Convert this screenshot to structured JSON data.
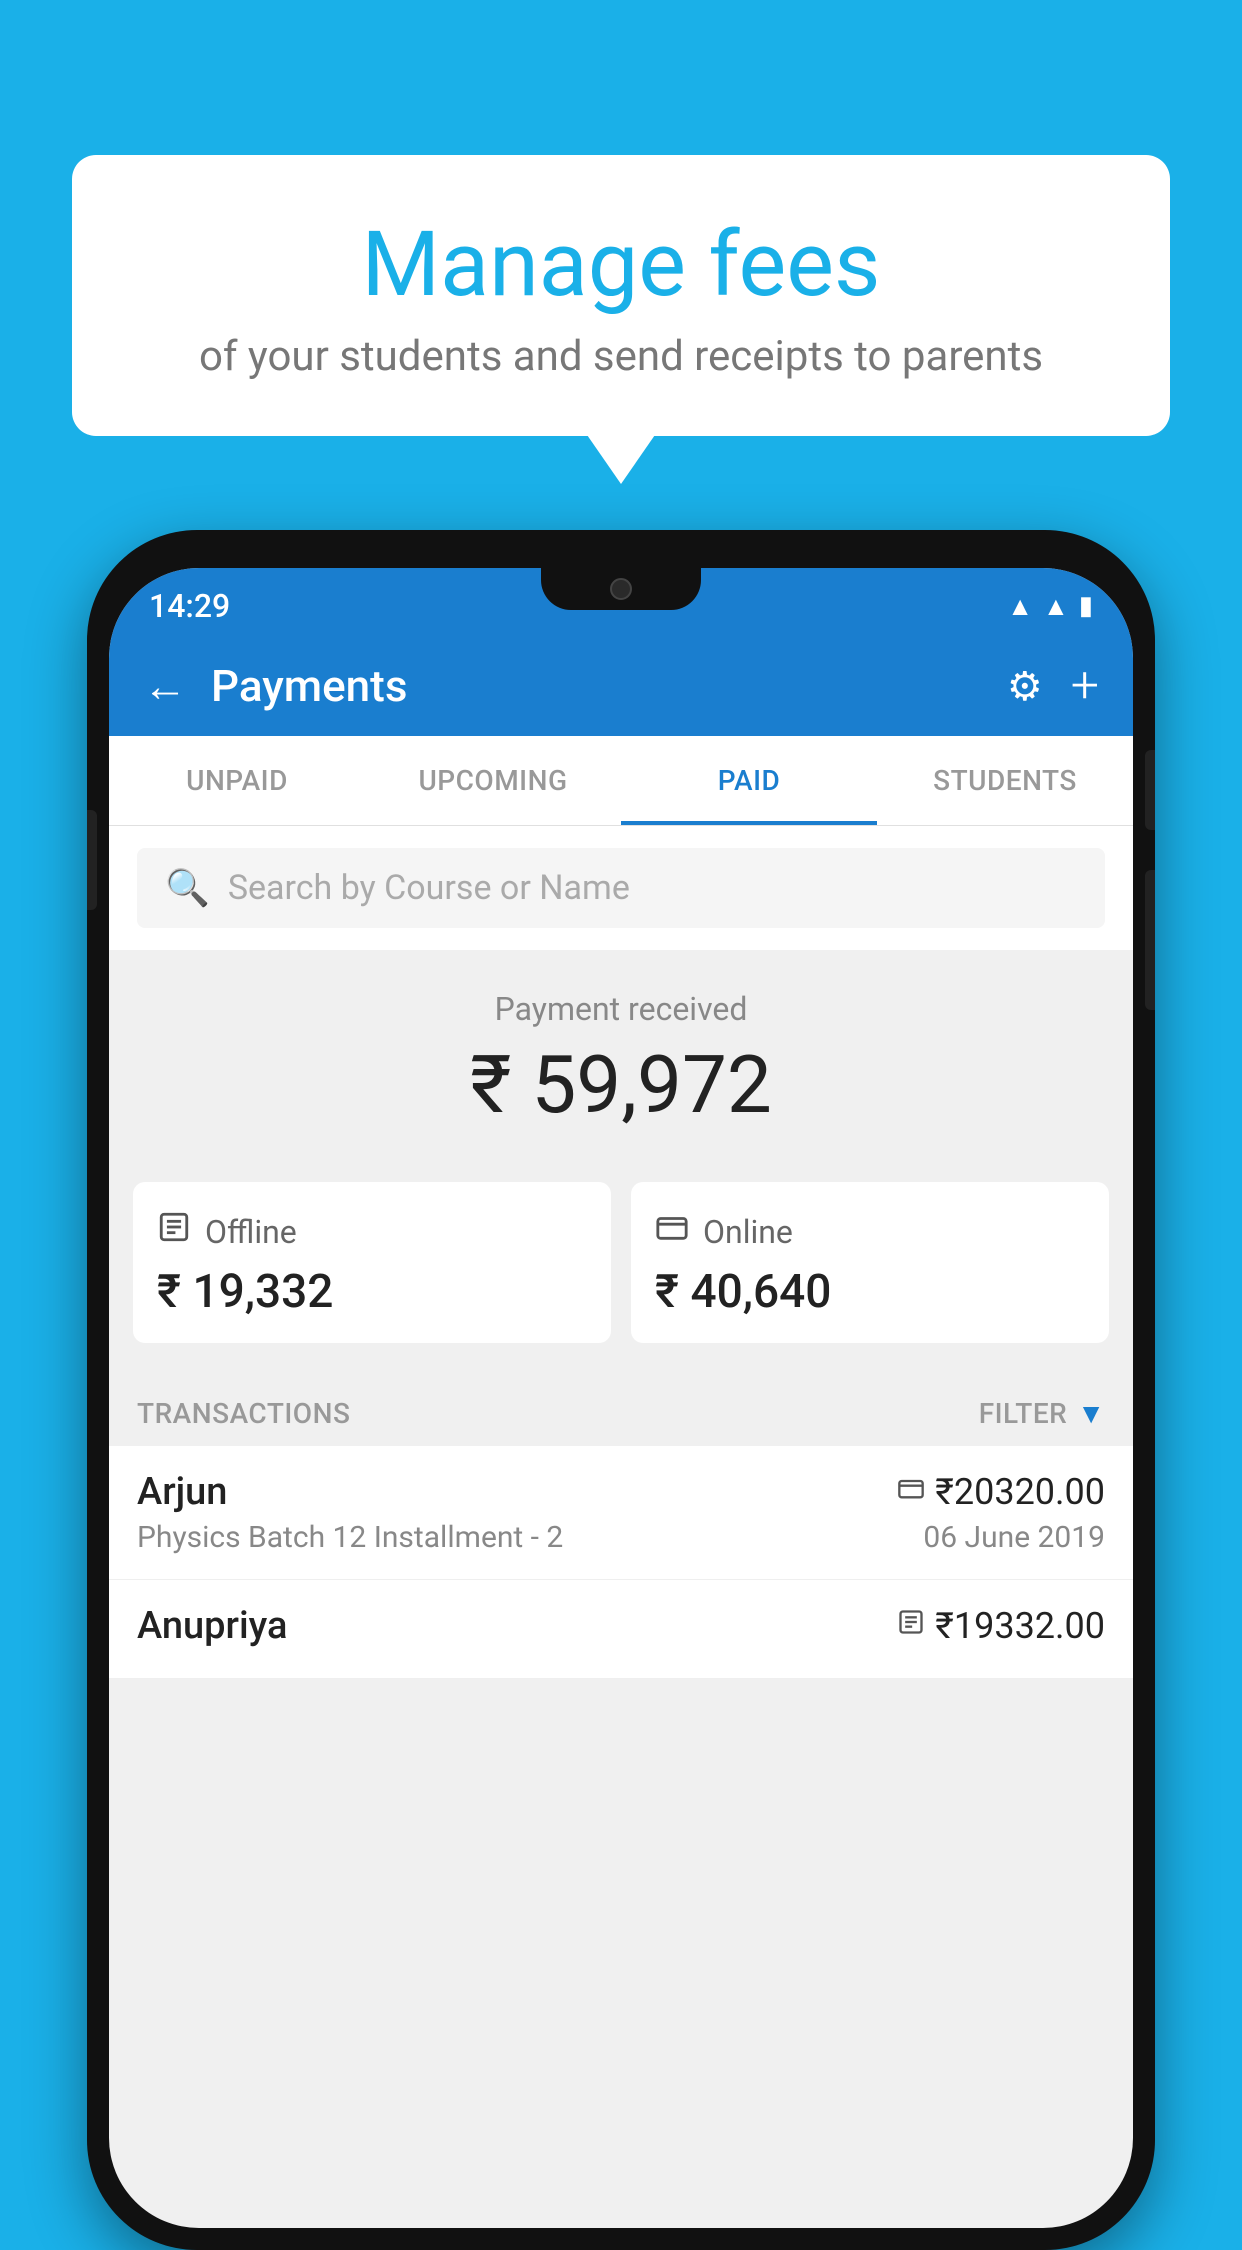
{
  "background_color": "#1ab0e8",
  "speech_bubble": {
    "title": "Manage fees",
    "subtitle": "of your students and send receipts to parents"
  },
  "status_bar": {
    "time": "14:29",
    "icons": [
      "wifi",
      "signal",
      "battery"
    ]
  },
  "app_bar": {
    "back_label": "←",
    "title": "Payments",
    "settings_icon": "⚙",
    "plus_icon": "+"
  },
  "tabs": [
    {
      "label": "UNPAID",
      "active": false
    },
    {
      "label": "UPCOMING",
      "active": false
    },
    {
      "label": "PAID",
      "active": true
    },
    {
      "label": "STUDENTS",
      "active": false
    }
  ],
  "search": {
    "placeholder": "Search by Course or Name"
  },
  "payment_summary": {
    "label": "Payment received",
    "amount": "₹ 59,972"
  },
  "payment_cards": [
    {
      "icon": "💳",
      "label": "Offline",
      "amount": "₹ 19,332"
    },
    {
      "icon": "💳",
      "label": "Online",
      "amount": "₹ 40,640"
    }
  ],
  "transactions_header": {
    "label": "TRANSACTIONS",
    "filter_label": "FILTER"
  },
  "transactions": [
    {
      "name": "Arjun",
      "payment_type": "online",
      "amount": "₹20320.00",
      "course": "Physics Batch 12 Installment - 2",
      "date": "06 June 2019"
    },
    {
      "name": "Anupriya",
      "payment_type": "offline",
      "amount": "₹19332.00",
      "course": "",
      "date": ""
    }
  ]
}
